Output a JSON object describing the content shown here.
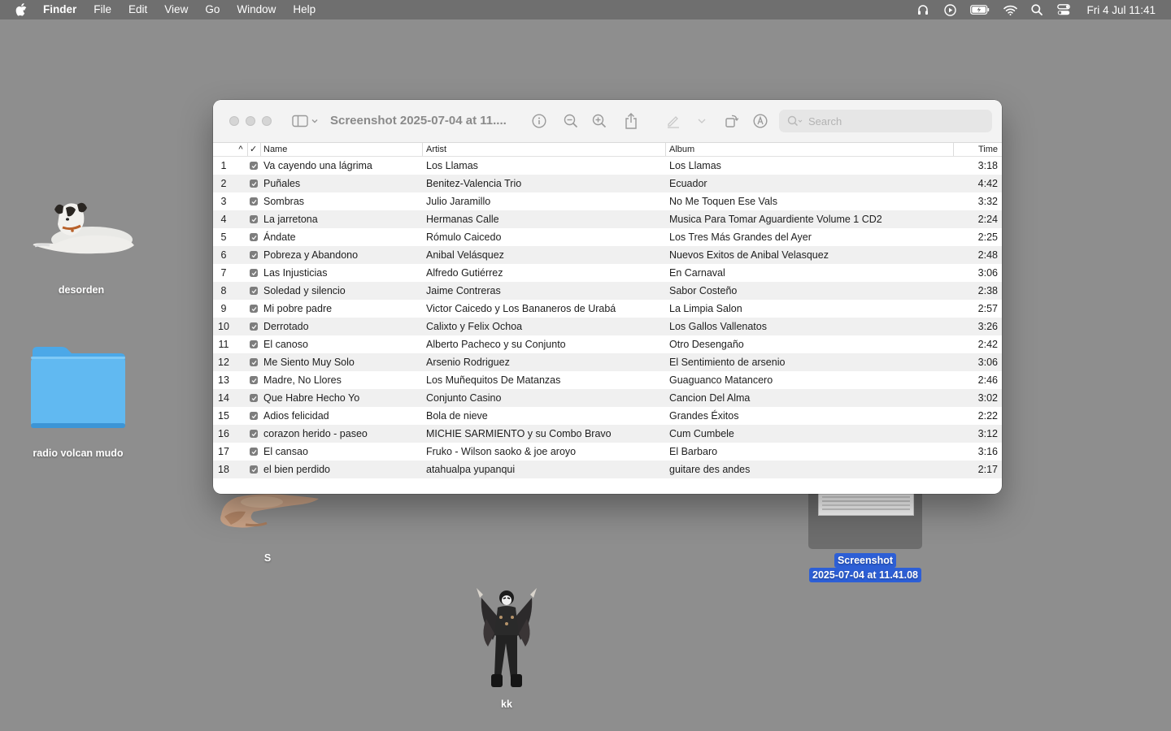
{
  "menubar": {
    "app": "Finder",
    "items": [
      "File",
      "Edit",
      "View",
      "Go",
      "Window",
      "Help"
    ],
    "status_icons": [
      "headphones-icon",
      "play-circle-icon",
      "battery-charging-icon",
      "wifi-icon",
      "search-icon",
      "control-center-icon"
    ],
    "clock": "Fri 4 Jul  11:41"
  },
  "desktop": {
    "items": [
      {
        "label": "desorden",
        "kind": "dog-figurine-image"
      },
      {
        "label": "radio volcan mudo",
        "kind": "folder-icon"
      },
      {
        "label": "S",
        "kind": "deer-figurine-image"
      },
      {
        "label": "kk",
        "kind": "costumed-figure-image"
      },
      {
        "label_line1": "Screenshot",
        "label_line2": "2025-07-04 at 11.41.08",
        "kind": "screenshot-thumbnail",
        "selected": true
      }
    ]
  },
  "window": {
    "title": "Screenshot 2025-07-04 at 11....",
    "search_placeholder": "Search",
    "toolbar_icons": [
      "sidebar-toggle-icon",
      "info-icon",
      "zoom-out-icon",
      "zoom-in-icon",
      "share-icon",
      "markup-pen-icon",
      "rotate-icon",
      "annotate-icon"
    ]
  },
  "table": {
    "columns": {
      "sort": "^",
      "check": "✓",
      "name": "Name",
      "artist": "Artist",
      "album": "Album",
      "time": "Time"
    },
    "rows": [
      {
        "n": "1",
        "name": "Va cayendo una lágrima",
        "artist": "Los Llamas",
        "album": "Los Llamas",
        "time": "3:18"
      },
      {
        "n": "2",
        "name": "Puñales",
        "artist": "Benitez-Valencia Trio",
        "album": "Ecuador",
        "time": "4:42"
      },
      {
        "n": "3",
        "name": "Sombras",
        "artist": "Julio Jaramillo",
        "album": "No Me Toquen Ese Vals",
        "time": "3:32"
      },
      {
        "n": "4",
        "name": "La jarretona",
        "artist": "Hermanas Calle",
        "album": "Musica Para Tomar Aguardiente Volume 1 CD2",
        "time": "2:24"
      },
      {
        "n": "5",
        "name": "Ándate",
        "artist": "Rómulo Caicedo",
        "album": "Los Tres Más Grandes del Ayer",
        "time": "2:25"
      },
      {
        "n": "6",
        "name": "Pobreza y Abandono",
        "artist": "Anibal Velásquez",
        "album": "Nuevos Exitos de Anibal Velasquez",
        "time": "2:48"
      },
      {
        "n": "7",
        "name": "Las Injusticias",
        "artist": "Alfredo Gutiérrez",
        "album": "En Carnaval",
        "time": "3:06"
      },
      {
        "n": "8",
        "name": "Soledad y silencio",
        "artist": "Jaime Contreras",
        "album": "Sabor Costeño",
        "time": "2:38"
      },
      {
        "n": "9",
        "name": "Mi pobre padre",
        "artist": "Victor Caicedo y Los Bananeros de Urabá",
        "album": "La Limpia Salon",
        "time": "2:57"
      },
      {
        "n": "10",
        "name": "Derrotado",
        "artist": "Calixto y Felix Ochoa",
        "album": "Los Gallos Vallenatos",
        "time": "3:26"
      },
      {
        "n": "11",
        "name": "El canoso",
        "artist": "Alberto Pacheco y su Conjunto",
        "album": "Otro Desengaño",
        "time": "2:42"
      },
      {
        "n": "12",
        "name": "Me Siento Muy Solo",
        "artist": "Arsenio Rodriguez",
        "album": "El Sentimiento de arsenio",
        "time": "3:06"
      },
      {
        "n": "13",
        "name": "Madre, No Llores",
        "artist": "Los Muñequitos De Matanzas",
        "album": "Guaguanco Matancero",
        "time": "2:46"
      },
      {
        "n": "14",
        "name": "Que Habre Hecho Yo",
        "artist": "Conjunto Casino",
        "album": "Cancion Del Alma",
        "time": "3:02"
      },
      {
        "n": "15",
        "name": "Adios felicidad",
        "artist": "Bola de nieve",
        "album": "Grandes Éxitos",
        "time": "2:22"
      },
      {
        "n": "16",
        "name": "corazon herido - paseo",
        "artist": "MICHIE SARMIENTO y su Combo Bravo",
        "album": "Cum Cumbele",
        "time": "3:12"
      },
      {
        "n": "17",
        "name": "El cansao",
        "artist": "Fruko - Wilson saoko & joe aroyo",
        "album": "El Barbaro",
        "time": "3:16"
      },
      {
        "n": "18",
        "name": "el bien perdido",
        "artist": "atahualpa yupanqui",
        "album": "guitare des andes",
        "time": "2:17"
      }
    ]
  },
  "colors": {
    "desktop": "#8e8e8e",
    "menubar": "#6f6f6f",
    "folder": "#5fb3ee",
    "selection": "#2d5fd6"
  }
}
